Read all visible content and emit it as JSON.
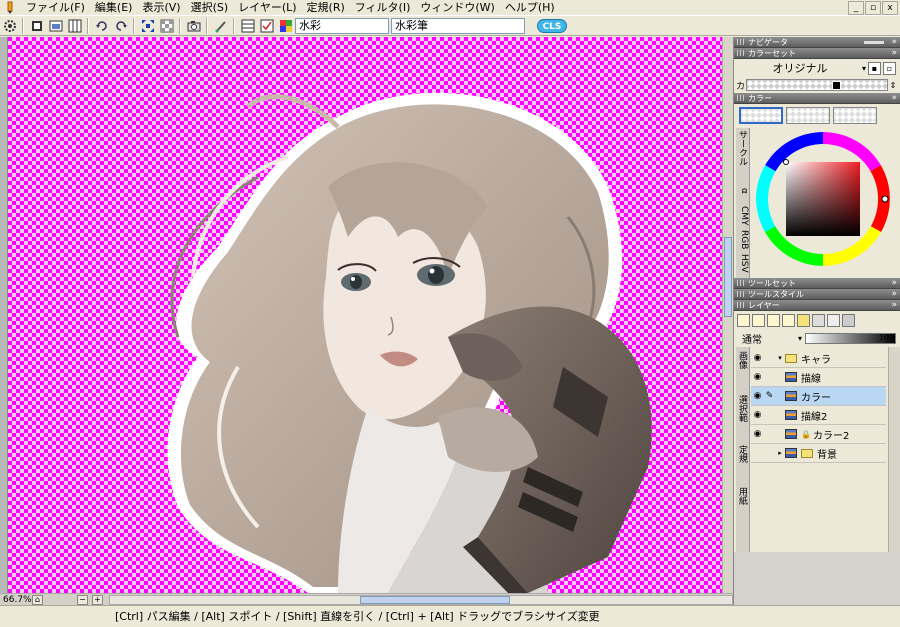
{
  "menubar": {
    "items": [
      "ファイル(F)",
      "編集(E)",
      "表示(V)",
      "選択(S)",
      "レイヤー(L)",
      "定規(R)",
      "フィルタ(I)",
      "ウィンドウ(W)",
      "ヘルプ(H)"
    ],
    "window_controls": [
      "_",
      "▫",
      "x"
    ]
  },
  "toolbar": {
    "brush_field": "水彩",
    "tool_field": "水彩筆",
    "logo_text": "CLS"
  },
  "navigator": {
    "zoom": "66.7%"
  },
  "statusbar": {
    "hint": "[Ctrl] パス編集 / [Alt] スポイト / [Shift] 直線を引く / [Ctrl] + [Alt] ドラッグでブラシサイズ変更"
  },
  "panels": {
    "navigator_title": "ナビゲータ",
    "colorset_title": "カラーセット",
    "colorset_name": "オリジナル",
    "swatch_label": "カ",
    "color_title": "カラー",
    "color_tabs": [
      "サークル",
      "α",
      "CMY",
      "RGB",
      "HSV"
    ],
    "toolset_title": "ツールセット",
    "toolstyle_title": "ツールスタイル",
    "layer_title": "レイヤー",
    "blend_mode": "通常",
    "opacity": "100",
    "layer_side_tabs": [
      "画像",
      "選択範",
      "定規",
      "用紙"
    ],
    "layers": [
      {
        "name": "キャラ",
        "type": "folder",
        "visible": true,
        "selected": false,
        "indent": 0
      },
      {
        "name": "描線",
        "type": "layer",
        "visible": true,
        "selected": false,
        "indent": 1
      },
      {
        "name": "カラー",
        "type": "layer",
        "visible": true,
        "selected": true,
        "indent": 1
      },
      {
        "name": "描線2",
        "type": "layer",
        "visible": true,
        "selected": false,
        "indent": 1
      },
      {
        "name": "カラー2",
        "type": "layer",
        "visible": true,
        "selected": false,
        "indent": 1,
        "locked": true
      },
      {
        "name": "背景",
        "type": "folder",
        "visible": false,
        "selected": false,
        "indent": 0
      }
    ]
  },
  "colors": {
    "canvas_transparency": "#ff00ff",
    "selection": "#b9d7f3",
    "accent": "#3fb6e8"
  }
}
